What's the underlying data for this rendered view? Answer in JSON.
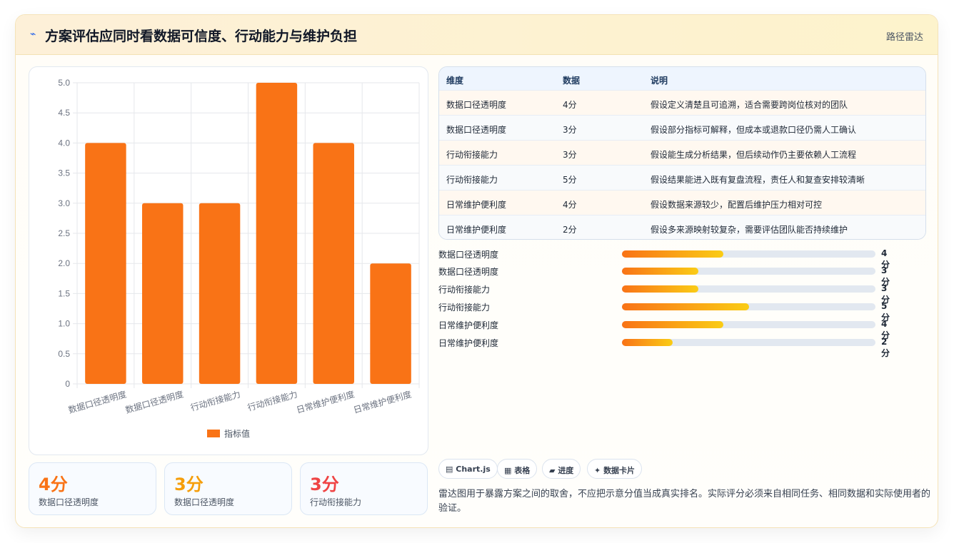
{
  "header": {
    "icon": "⌁",
    "title": "方案评估应同时看数据可信度、行动能力与维护负担",
    "tag": "路径雷达"
  },
  "colors": {
    "bar": "#f97316",
    "accent_blue": "#2563eb"
  },
  "chart_data": {
    "type": "bar",
    "categories": [
      "数据口径透明度",
      "数据口径透明度",
      "行动衔接能力",
      "行动衔接能力",
      "日常维护便利度",
      "日常维护便利度"
    ],
    "series": [
      {
        "name": "指标值",
        "values": [
          4,
          3,
          3,
          5,
          4,
          2
        ]
      }
    ],
    "ylim": [
      0,
      5
    ],
    "yticks": [
      "0",
      "0.5",
      "1.0",
      "1.5",
      "2.0",
      "2.5",
      "3.0",
      "3.5",
      "4.0",
      "4.5",
      "5.0"
    ],
    "grid": true,
    "legend": "bottom"
  },
  "stats": [
    {
      "value": "4分",
      "label": "数据口径透明度",
      "color": "#f97316"
    },
    {
      "value": "3分",
      "label": "数据口径透明度",
      "color": "#f59e0b"
    },
    {
      "value": "3分",
      "label": "行动衔接能力",
      "color": "#ef4444"
    }
  ],
  "table": {
    "headers": [
      "维度",
      "数据",
      "说明"
    ],
    "rows": [
      [
        "数据口径透明度",
        "4分",
        "假设定义清楚且可追溯，适合需要跨岗位核对的团队"
      ],
      [
        "数据口径透明度",
        "3分",
        "假设部分指标可解释，但成本或退款口径仍需人工确认"
      ],
      [
        "行动衔接能力",
        "3分",
        "假设能生成分析结果，但后续动作仍主要依赖人工流程"
      ],
      [
        "行动衔接能力",
        "5分",
        "假设结果能进入既有复盘流程，责任人和复查安排较清晰"
      ],
      [
        "日常维护便利度",
        "4分",
        "假设数据来源较少，配置后维护压力相对可控"
      ],
      [
        "日常维护便利度",
        "2分",
        "假设多来源映射较复杂，需要评估团队能否持续维护"
      ]
    ]
  },
  "progress": [
    {
      "label": "数据口径透明度",
      "value": 4,
      "text": "4分"
    },
    {
      "label": "数据口径透明度",
      "value": 3,
      "text": "3分"
    },
    {
      "label": "行动衔接能力",
      "value": 3,
      "text": "3分"
    },
    {
      "label": "行动衔接能力",
      "value": 5,
      "text": "5分"
    },
    {
      "label": "日常维护便利度",
      "value": 4,
      "text": "4分"
    },
    {
      "label": "日常维护便利度",
      "value": 2,
      "text": "2分"
    }
  ],
  "progress_max": 10,
  "chips": [
    {
      "icon": "▤",
      "label": "Chart.js"
    },
    {
      "icon": "▦",
      "label": "表格"
    },
    {
      "icon": "▰",
      "label": "进度"
    },
    {
      "icon": "✦",
      "label": "数据卡片"
    }
  ],
  "note": "雷达图用于暴露方案之间的取舍，不应把示意分值当成真实排名。实际评分必须来自相同任务、相同数据和实际使用者的验证。"
}
